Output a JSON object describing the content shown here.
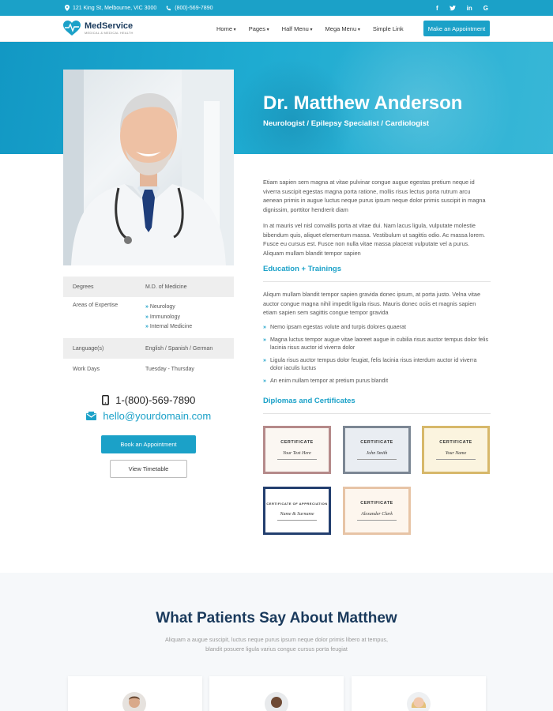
{
  "topbar": {
    "address": "121 King St, Melbourne, VIC 3000",
    "phone": "(800)-569-7890",
    "social": [
      "facebook-icon",
      "twitter-icon",
      "linkedin-icon",
      "google-icon"
    ]
  },
  "header": {
    "logo_name": "MedService",
    "logo_tag": "MEDICAL & MEDICAL HEALTH",
    "nav": [
      "Home",
      "Pages",
      "Half Menu",
      "Mega Menu",
      "Simple Link"
    ],
    "appointment_label": "Make an Appointment"
  },
  "hero": {
    "name": "Dr. Matthew Anderson",
    "specialty": "Neurologist / Epilepsy Specialist / Cardiologist"
  },
  "info": {
    "degrees_label": "Degrees",
    "degrees_value": "M.D. of Medicine",
    "expertise_label": "Areas of Expertise",
    "expertise": [
      "Neurology",
      "Immunology",
      "Internal Medicine"
    ],
    "language_label": "Language(s)",
    "language_value": "English / Spanish / German",
    "workdays_label": "Work Days",
    "workdays_value": "Tuesday - Thursday"
  },
  "contact": {
    "phone": "1-(800)-569-7890",
    "email": "hello@yourdomain.com",
    "book_label": "Book an Appointment",
    "timetable_label": "View Timetable"
  },
  "about": {
    "p1": "Etiam sapien sem magna at vitae pulvinar congue augue egestas pretium neque id viverra suscipit egestas magna porta ratione, mollis risus lectus porta rutrum arcu aenean primis in augue luctus neque purus ipsum neque dolor primis suscipit in magna dignissim, porttitor hendrerit diam",
    "p2": "In at mauris vel nisl convallis porta at vitae dui. Nam lacus ligula, vulputate molestie bibendum quis, aliquet elementum massa. Vestibulum ut sagittis odio. Ac massa lorem. Fusce eu cursus est. Fusce non nulla vitae massa placerat vulputate vel a purus. Aliquam mullam blandit tempor sapien"
  },
  "education": {
    "title": "Education + Trainings",
    "text": "Aliqum mullam blandit tempor sapien gravida donec ipsum, at porta justo. Velna vitae auctor congue magna nihil impedit ligula risus. Mauris donec ociis et magnis sapien etiam sapien sem sagittis congue tempor gravida",
    "bullets": [
      "Nemo ipsam egestas volute and turpis dolores quaerat",
      "Magna luctus tempor augue vitae laoreet augue in cubilia risus auctor tempus dolor felis lacinia risus auctor id viverra dolor",
      "Ligula risus auctor tempus dolor feugiat, felis lacinia risus interdum auctor id viverra dolor iaculis luctus",
      "An enim nullam tempor at pretium purus blandit"
    ]
  },
  "diplomas": {
    "title": "Diplomas and Certificates",
    "certs": [
      {
        "heading": "CERTIFICATE",
        "signature": "Your Text Here",
        "frame": "#b58a8a",
        "paper": "#fbf7f2"
      },
      {
        "heading": "CERTIFICATE",
        "signature": "John Smith",
        "frame": "#7c8794",
        "paper": "#e9edf2"
      },
      {
        "heading": "CERTIFICATE",
        "signature": "Your Name",
        "frame": "#d7b86a",
        "paper": "#fbf4df"
      },
      {
        "heading": "CERTIFICATE OF APPRECIATION",
        "signature": "Name & Surname",
        "frame": "#233f6f",
        "paper": "#ffffff"
      },
      {
        "heading": "CERTIFICATE",
        "signature": "Alexander Clark",
        "frame": "#e7c4a6",
        "paper": "#fdf6ee"
      }
    ]
  },
  "testimonials": {
    "title": "What Patients Say About Matthew",
    "subtitle": "Aliquam a augue suscipit, luctus neque purus ipsum neque dolor primis libero at tempus, blandit posuere ligula varius congue cursus porta feugiat"
  },
  "colors": {
    "accent": "#1ba1c8",
    "navy": "#1a3a5c"
  }
}
